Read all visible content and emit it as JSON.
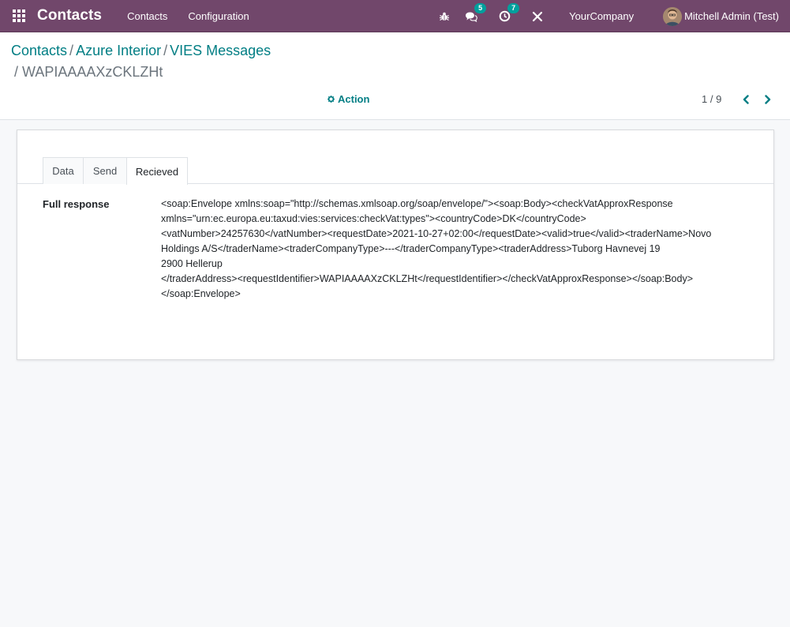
{
  "navbar": {
    "app_name": "Contacts",
    "menu": [
      "Contacts",
      "Configuration"
    ],
    "messages_badge": "5",
    "activities_badge": "7",
    "company": "YourCompany",
    "user": "Mitchell Admin (Test)",
    "accent_color": "#71476b"
  },
  "breadcrumb": {
    "items": [
      "Contacts",
      "Azure Interior",
      "VIES Messages"
    ],
    "current": "/ WAPIAAAAXzCKLZHt"
  },
  "toolbar": {
    "action_label": "Action",
    "pager": "1 / 9"
  },
  "tabs": [
    {
      "label": "Data",
      "active": false
    },
    {
      "label": "Send",
      "active": false
    },
    {
      "label": "Recieved",
      "active": true
    }
  ],
  "field": {
    "label": "Full response",
    "value": "<soap:Envelope xmlns:soap=\"http://schemas.xmlsoap.org/soap/envelope/\"><soap:Body><checkVatApproxResponse xmlns=\"urn:ec.europa.eu:taxud:vies:services:checkVat:types\"><countryCode>DK</countryCode><vatNumber>24257630</vatNumber><requestDate>2021-10-27+02:00</requestDate><valid>true</valid><traderName>Novo Holdings A/S</traderName><traderCompanyType>---</traderCompanyType><traderAddress>Tuborg Havnevej 19\n2900 Hellerup\n</traderAddress><requestIdentifier>WAPIAAAAXzCKLZHt</requestIdentifier></checkVatApproxResponse></soap:Body></soap:Envelope>"
  }
}
